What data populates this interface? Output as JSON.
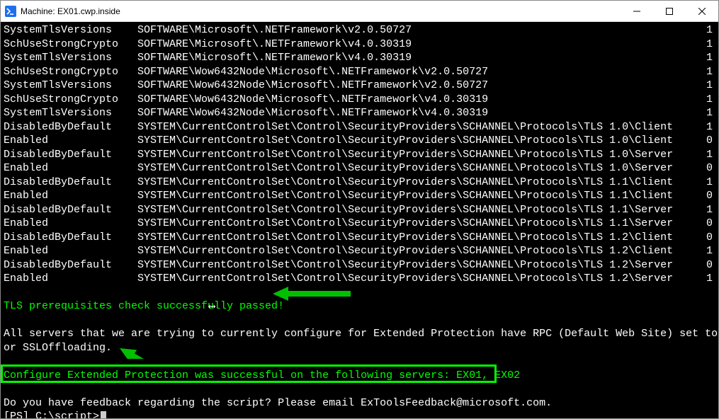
{
  "window": {
    "title": "Machine: EX01.cwp.inside"
  },
  "rows": [
    {
      "k": "SystemTlsVersions",
      "p": "SOFTWARE\\Microsoft\\.NETFramework\\v2.0.50727",
      "v": "1"
    },
    {
      "k": "SchUseStrongCrypto",
      "p": "SOFTWARE\\Microsoft\\.NETFramework\\v4.0.30319",
      "v": "1"
    },
    {
      "k": "SystemTlsVersions",
      "p": "SOFTWARE\\Microsoft\\.NETFramework\\v4.0.30319",
      "v": "1"
    },
    {
      "k": "SchUseStrongCrypto",
      "p": "SOFTWARE\\Wow6432Node\\Microsoft\\.NETFramework\\v2.0.50727",
      "v": "1"
    },
    {
      "k": "SystemTlsVersions",
      "p": "SOFTWARE\\Wow6432Node\\Microsoft\\.NETFramework\\v2.0.50727",
      "v": "1"
    },
    {
      "k": "SchUseStrongCrypto",
      "p": "SOFTWARE\\Wow6432Node\\Microsoft\\.NETFramework\\v4.0.30319",
      "v": "1"
    },
    {
      "k": "SystemTlsVersions",
      "p": "SOFTWARE\\Wow6432Node\\Microsoft\\.NETFramework\\v4.0.30319",
      "v": "1"
    },
    {
      "k": "DisabledByDefault",
      "p": "SYSTEM\\CurrentControlSet\\Control\\SecurityProviders\\SCHANNEL\\Protocols\\TLS 1.0\\Client",
      "v": "1"
    },
    {
      "k": "Enabled",
      "p": "SYSTEM\\CurrentControlSet\\Control\\SecurityProviders\\SCHANNEL\\Protocols\\TLS 1.0\\Client",
      "v": "0"
    },
    {
      "k": "DisabledByDefault",
      "p": "SYSTEM\\CurrentControlSet\\Control\\SecurityProviders\\SCHANNEL\\Protocols\\TLS 1.0\\Server",
      "v": "1"
    },
    {
      "k": "Enabled",
      "p": "SYSTEM\\CurrentControlSet\\Control\\SecurityProviders\\SCHANNEL\\Protocols\\TLS 1.0\\Server",
      "v": "0"
    },
    {
      "k": "DisabledByDefault",
      "p": "SYSTEM\\CurrentControlSet\\Control\\SecurityProviders\\SCHANNEL\\Protocols\\TLS 1.1\\Client",
      "v": "1"
    },
    {
      "k": "Enabled",
      "p": "SYSTEM\\CurrentControlSet\\Control\\SecurityProviders\\SCHANNEL\\Protocols\\TLS 1.1\\Client",
      "v": "0"
    },
    {
      "k": "DisabledByDefault",
      "p": "SYSTEM\\CurrentControlSet\\Control\\SecurityProviders\\SCHANNEL\\Protocols\\TLS 1.1\\Server",
      "v": "1"
    },
    {
      "k": "Enabled",
      "p": "SYSTEM\\CurrentControlSet\\Control\\SecurityProviders\\SCHANNEL\\Protocols\\TLS 1.1\\Server",
      "v": "0"
    },
    {
      "k": "DisabledByDefault",
      "p": "SYSTEM\\CurrentControlSet\\Control\\SecurityProviders\\SCHANNEL\\Protocols\\TLS 1.2\\Client",
      "v": "0"
    },
    {
      "k": "Enabled",
      "p": "SYSTEM\\CurrentControlSet\\Control\\SecurityProviders\\SCHANNEL\\Protocols\\TLS 1.2\\Client",
      "v": "1"
    },
    {
      "k": "DisabledByDefault",
      "p": "SYSTEM\\CurrentControlSet\\Control\\SecurityProviders\\SCHANNEL\\Protocols\\TLS 1.2\\Server",
      "v": "0"
    },
    {
      "k": "Enabled",
      "p": "SYSTEM\\CurrentControlSet\\Control\\SecurityProviders\\SCHANNEL\\Protocols\\TLS 1.2\\Server",
      "v": "1"
    }
  ],
  "messages": {
    "tls_ok": "TLS prerequisites check successfully passed!",
    "servers_note_line1": "All servers that we are trying to currently configure for Extended Protection have RPC (Default Web Site) set to false f",
    "servers_note_line2": "or SSLOffloading.",
    "success_line": "Configure Extended Protection was successful on the following servers: EX01, EX02",
    "feedback": "Do you have feedback regarding the script? Please email ExToolsFeedback@microsoft.com.",
    "prompt": "[PS] C:\\script>"
  }
}
